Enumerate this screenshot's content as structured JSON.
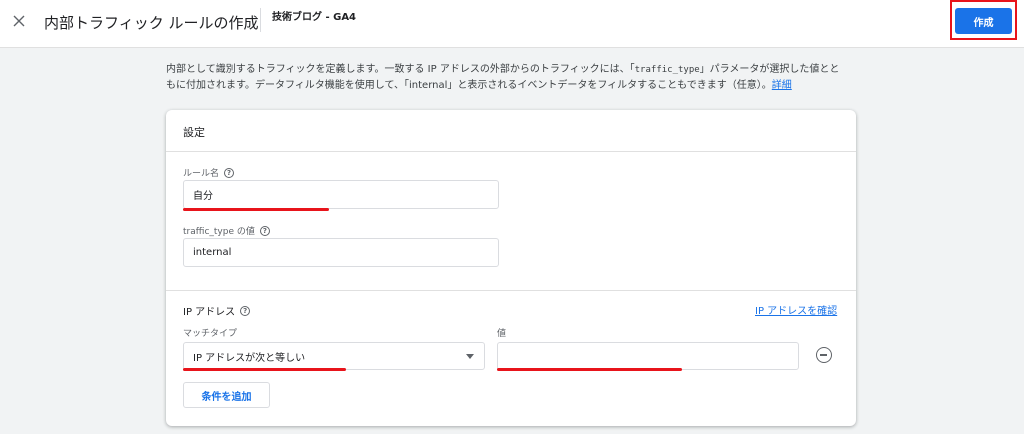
{
  "header": {
    "title": "内部トラフィック ルールの作成",
    "property": "技術ブログ - GA4",
    "create_label": "作成"
  },
  "description": {
    "line1_a": "内部として識別するトラフィックを定義します。一致する IP アドレスの外部からのトラフィックには、「",
    "line1_code": "traffic_type",
    "line1_b": "」パラメータが選択した値とと",
    "line2": "もに付加されます。データフィルタ機能を使用して、「internal」と表示されるイベントデータをフィルタすることもできます（任意）。",
    "link": "詳細"
  },
  "settings": {
    "title": "設定",
    "rule_name_label": "ルール名",
    "rule_name_value": "自分",
    "traffic_type_label": "traffic_type の値",
    "traffic_type_value": "internal"
  },
  "ip": {
    "title": "IP アドレス",
    "confirm_link": "IP アドレスを確認",
    "match_type_label": "マッチタイプ",
    "match_type_value": "IP アドレスが次と等しい",
    "value_label": "値",
    "value": ""
  },
  "add_condition_label": "条件を追加",
  "colors": {
    "accent": "#1a73e8",
    "highlight": "#e8141b"
  }
}
